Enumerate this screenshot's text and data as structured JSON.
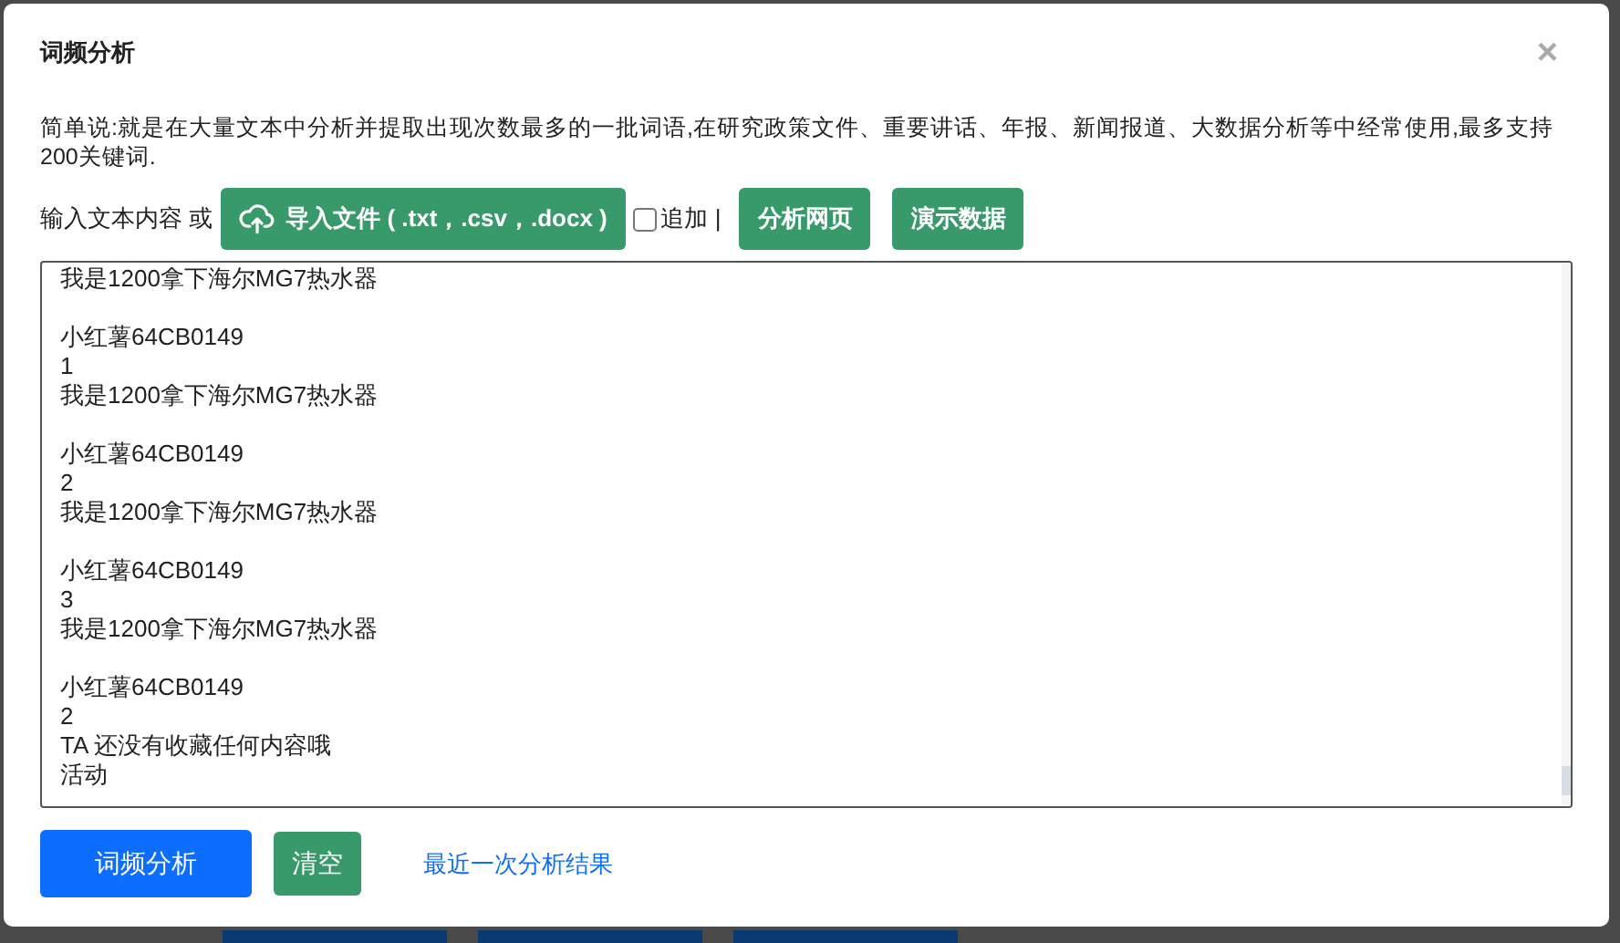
{
  "dialog": {
    "title": "词频分析",
    "close": "×"
  },
  "description": "简单说:就是在大量文本中分析并提取出现次数最多的一批词语,在研究政策文件、重要讲话、年报、新闻报道、大数据分析等中经常使用,最多支持200关键词.",
  "input_row": {
    "label": "输入文本内容 或",
    "import_button": "导入文件 ( .txt，.csv，.docx )",
    "append": {
      "label": "追加",
      "checked": false
    },
    "separator": "|",
    "buttons": [
      "分析网页",
      "演示数据"
    ]
  },
  "text_area": {
    "paragraphs": [
      {
        "lines": [
          "我是1200拿下海尔MG7热水器"
        ]
      },
      {
        "lines": [
          "小红薯64CB0149",
          "1",
          "我是1200拿下海尔MG7热水器"
        ]
      },
      {
        "lines": [
          "小红薯64CB0149",
          "2",
          "我是1200拿下海尔MG7热水器"
        ]
      },
      {
        "lines": [
          "小红薯64CB0149",
          "3",
          "我是1200拿下海尔MG7热水器"
        ]
      },
      {
        "lines": [
          "小红薯64CB0149",
          "2",
          "TA 还没有收藏任何内容哦",
          "活动"
        ]
      }
    ]
  },
  "footer": {
    "analyze_button": "词频分析",
    "clear_button": "清空",
    "recent_link": "最近一次分析结果"
  }
}
